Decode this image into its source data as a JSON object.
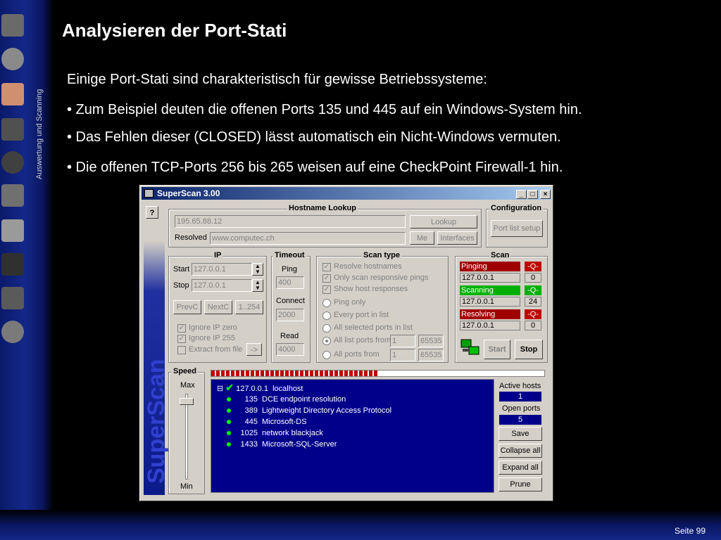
{
  "slide": {
    "title": "Analysieren der Port-Stati",
    "side_caption": "Auswertung und Scanning",
    "page_number": "Seite 99",
    "lines": [
      "Einige Port-Stati sind charakteristisch für gewisse Betriebssysteme:",
      "• Zum Beispiel deuten die offenen Ports 135 und 445 auf ein Windows-System hin.",
      "• Das Fehlen dieser (CLOSED) lässt automatisch ein Nicht-Windows vermuten.",
      "• Die offenen TCP-Ports 256 bis 265 weisen auf eine CheckPoint Firewall-1 hin."
    ]
  },
  "window": {
    "title": "SuperScan 3.00",
    "brand": "SuperScan",
    "help_label": "?",
    "controls": {
      "minimize": "_",
      "maximize": "□",
      "close": "×"
    },
    "hostname_lookup": {
      "title": "Hostname Lookup",
      "host_value": "195.65.88.12",
      "resolved_label": "Resolved",
      "resolved_value": "www.computec.ch",
      "lookup_btn": "Lookup",
      "me_btn": "Me",
      "interfaces_btn": "Interfaces"
    },
    "configuration": {
      "title": "Configuration",
      "port_list_btn": "Port list setup"
    },
    "ip": {
      "title": "IP",
      "start_label": "Start",
      "start_value": "127.0.0.1",
      "stop_label": "Stop",
      "stop_value": "127.0.0.1",
      "prevc_btn": "PrevC",
      "nextc_btn": "NextC",
      "range_btn": "1..254",
      "ignore_zero": "Ignore IP zero",
      "ignore_255": "Ignore IP 255",
      "extract": "Extract from file",
      "extract_btn": "->"
    },
    "timeout": {
      "title": "Timeout",
      "ping_label": "Ping",
      "ping_value": "400",
      "connect_label": "Connect",
      "connect_value": "2000",
      "read_label": "Read",
      "read_value": "4000"
    },
    "scan_type": {
      "title": "Scan type",
      "resolve": "Resolve hostnames",
      "only_responsive": "Only scan responsive pings",
      "show_host": "Show host responses",
      "ping_only": "Ping only",
      "every_port": "Every port in list",
      "all_selected": "All selected ports in list",
      "all_list_ports": "All list ports from",
      "all_list_from": "1",
      "all_list_to": "65535",
      "all_ports": "All ports from",
      "all_ports_from": "1",
      "all_ports_to": "65535"
    },
    "scan": {
      "title": "Scan",
      "pinging_label": "Pinging",
      "pinging_flag": "-Q-",
      "pinging_ip": "127.0.0.1",
      "pinging_count": "0",
      "scanning_label": "Scanning",
      "scanning_flag": "-Q-",
      "scanning_ip": "127.0.0.1",
      "scanning_count": "24",
      "resolving_label": "Resolving",
      "resolving_flag": "-Q-",
      "resolving_ip": "127.0.0.1",
      "resolving_count": "0",
      "start_btn": "Start",
      "stop_btn": "Stop"
    },
    "speed": {
      "title": "Speed",
      "max": "Max",
      "min": "Min",
      "level": 0.95
    },
    "progress": 0.5,
    "results": {
      "root_minus": "⊟",
      "root_host": "127.0.0.1",
      "root_name": "localhost",
      "items": [
        {
          "port": "135",
          "name": "DCE endpoint resolution"
        },
        {
          "port": "389",
          "name": "Lightweight Directory Access Protocol"
        },
        {
          "port": "445",
          "name": "Microsoft-DS"
        },
        {
          "port": "1025",
          "name": "network blackjack"
        },
        {
          "port": "1433",
          "name": "Microsoft-SQL-Server"
        }
      ]
    },
    "stats": {
      "active_hosts_label": "Active hosts",
      "active_hosts": "1",
      "open_ports_label": "Open ports",
      "open_ports": "5",
      "save_btn": "Save",
      "collapse_btn": "Collapse all",
      "expand_btn": "Expand all",
      "prune_btn": "Prune"
    },
    "colors": {
      "pinging": "#a00000",
      "scanning": "#00b000",
      "resolving": "#a00000",
      "flag": "#c00000"
    }
  }
}
